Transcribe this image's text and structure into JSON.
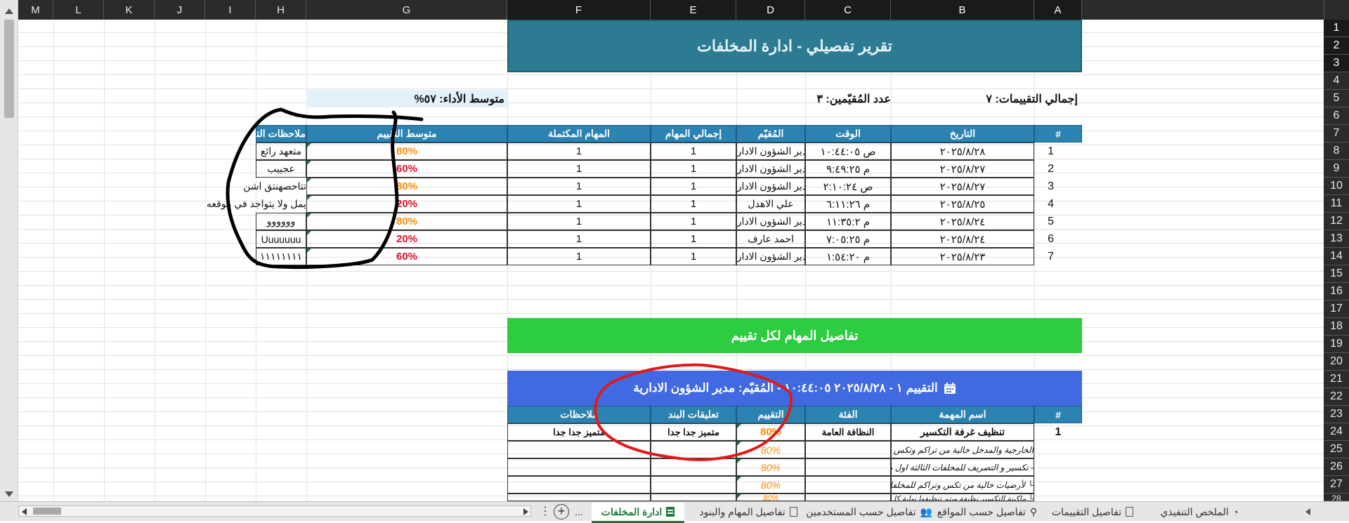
{
  "columns": [
    "M",
    "L",
    "K",
    "J",
    "I",
    "H",
    "G",
    "F",
    "E",
    "D",
    "C",
    "B",
    "A"
  ],
  "rows": [
    "1",
    "2",
    "3",
    "4",
    "5",
    "6",
    "7",
    "8",
    "9",
    "10",
    "11",
    "12",
    "13",
    "14",
    "15",
    "16",
    "17",
    "18",
    "19",
    "20",
    "21",
    "22",
    "23",
    "24",
    "25",
    "26",
    "27",
    "28"
  ],
  "report": {
    "title": "تقرير تفصيلي - ادارة المخلفات",
    "total_label": "إجمالي التقييمات: ٧",
    "evaluators_label": "عدد المُقيّمين: ٣",
    "avg_label": "متوسط الأداء: ٥٧%"
  },
  "summary_table": {
    "headers": [
      "#",
      "التاريخ",
      "الوقت",
      "المُقيّم",
      "إجمالي المهام",
      "المهام المكتملة",
      "متوسط التقييم",
      "ملاحظات التقييم"
    ],
    "rows": [
      {
        "n": "1",
        "date": "٢٠٢٥/٨/٢٨",
        "time": "ص ١٠:٤٤:٠٥",
        "evaluator": "مدير الشؤون الادارية",
        "total": "1",
        "done": "1",
        "avg": "80%",
        "avg_color": "#ff8c00",
        "note": "متعهد رائع"
      },
      {
        "n": "2",
        "date": "٢٠٢٥/٨/٢٧",
        "time": "م ٩:٤٩:٢٥",
        "evaluator": "مدير الشؤون الادارية",
        "total": "1",
        "done": "1",
        "avg": "60%",
        "avg_color": "#e0102a",
        "note": "عجييب"
      },
      {
        "n": "3",
        "date": "٢٠٢٥/٨/٢٧",
        "time": "ص ٢:١٠:٢٤",
        "evaluator": "مدير الشؤون الادارية",
        "total": "1",
        "done": "1",
        "avg": "80%",
        "avg_color": "#ff8c00",
        "note": "تتاحصهنتق اشن"
      },
      {
        "n": "4",
        "date": "٢٠٢٥/٨/٢٥",
        "time": "م ٦:١١:٢٦",
        "evaluator": "علي الاهدل",
        "total": "1",
        "done": "1",
        "avg": "20%",
        "avg_color": "#e0102a",
        "note": "يمل ولا يتواجد في موقعه"
      },
      {
        "n": "5",
        "date": "٢٠٢٥/٨/٢٤",
        "time": "م ١١:٣٥:٢",
        "evaluator": "مدير الشؤون الادارية",
        "total": "1",
        "done": "1",
        "avg": "80%",
        "avg_color": "#ff8c00",
        "note": "وووووو"
      },
      {
        "n": "6",
        "date": "٢٠٢٥/٨/٢٤",
        "time": "م ٧:٠٥:٢٥",
        "evaluator": "احمد عارف",
        "total": "1",
        "done": "1",
        "avg": "20%",
        "avg_color": "#e0102a",
        "note": "Uuuuuuu"
      },
      {
        "n": "7",
        "date": "٢٠٢٥/٨/٢٣",
        "time": "م ١:٥٤:٢٠",
        "evaluator": "مدير الشؤون الادارية",
        "total": "1",
        "done": "1",
        "avg": "60%",
        "avg_color": "#e0102a",
        "note": "١١١١١١١١"
      }
    ]
  },
  "details": {
    "banner": "تفاصيل المهام لكل تقييم",
    "eval_header": "التقييم ١ - ٢٠٢٥/٨/٢٨ ١٠:٤٤:٠٥ - المُقيّم: مدير الشؤون الادارية",
    "headers": [
      "#",
      "اسم المهمة",
      "الفئة",
      "التقييم",
      "تعليقات البند",
      "ملاحظات"
    ],
    "rows": [
      {
        "n": "1",
        "task": "تنظيف غرفة التكسير",
        "category": "النظافة العامة",
        "score": "80%",
        "comment": "متميز جدا جدا",
        "notes": "متميز جدا جدا",
        "bold": true
      },
      {
        "n": "",
        "task": "الخارجية والمدخل خالية من تراكم وتكس المخلفات والمبعثر",
        "category": "",
        "score": "80%",
        "comment": "",
        "notes": "",
        "bold": false
      },
      {
        "n": "",
        "task": "تكسير و التصريف للمخلفات الثالثة اول باول بشكل يومي -",
        "category": "",
        "score": "80%",
        "comment": "",
        "notes": "",
        "bold": false
      },
      {
        "n": "",
        "task": "لأرضيات خالية من تكس وتراكم للمخلفات والمبعثرات └",
        "category": "",
        "score": "80%",
        "comment": "",
        "notes": "",
        "bold": false
      },
      {
        "n": "",
        "task": "ماكينة التكسير نظيفة ويتم تنظيفها نهاية كل وردية عمل └",
        "category": "",
        "score": "80%",
        "comment": "",
        "notes": "",
        "bold": false
      }
    ]
  },
  "sheet_tabs": [
    {
      "label": "ادارة المخلفات",
      "active": true,
      "icon": "sheet-icon"
    },
    {
      "label": "تفاصيل المهام والبنود",
      "active": false,
      "icon": "document-icon"
    },
    {
      "label": "تفاصيل حسب المستخدمين",
      "active": false,
      "icon": "users-icon"
    },
    {
      "label": "تفاصيل حسب المواقع",
      "active": false,
      "icon": "location-icon"
    },
    {
      "label": "تفاصيل التقييمات",
      "active": false,
      "icon": "document-icon"
    },
    {
      "label": "الملخص التنفيذي",
      "active": false,
      "icon": "gauge-icon"
    }
  ],
  "tab_overflow": "...",
  "colors": {
    "title_bg": "#2d7a93",
    "header_bg": "#2c82b0",
    "green_banner": "#2ecc40",
    "blue_banner": "#4169e1",
    "orange": "#ff8c00",
    "red": "#e0102a"
  }
}
